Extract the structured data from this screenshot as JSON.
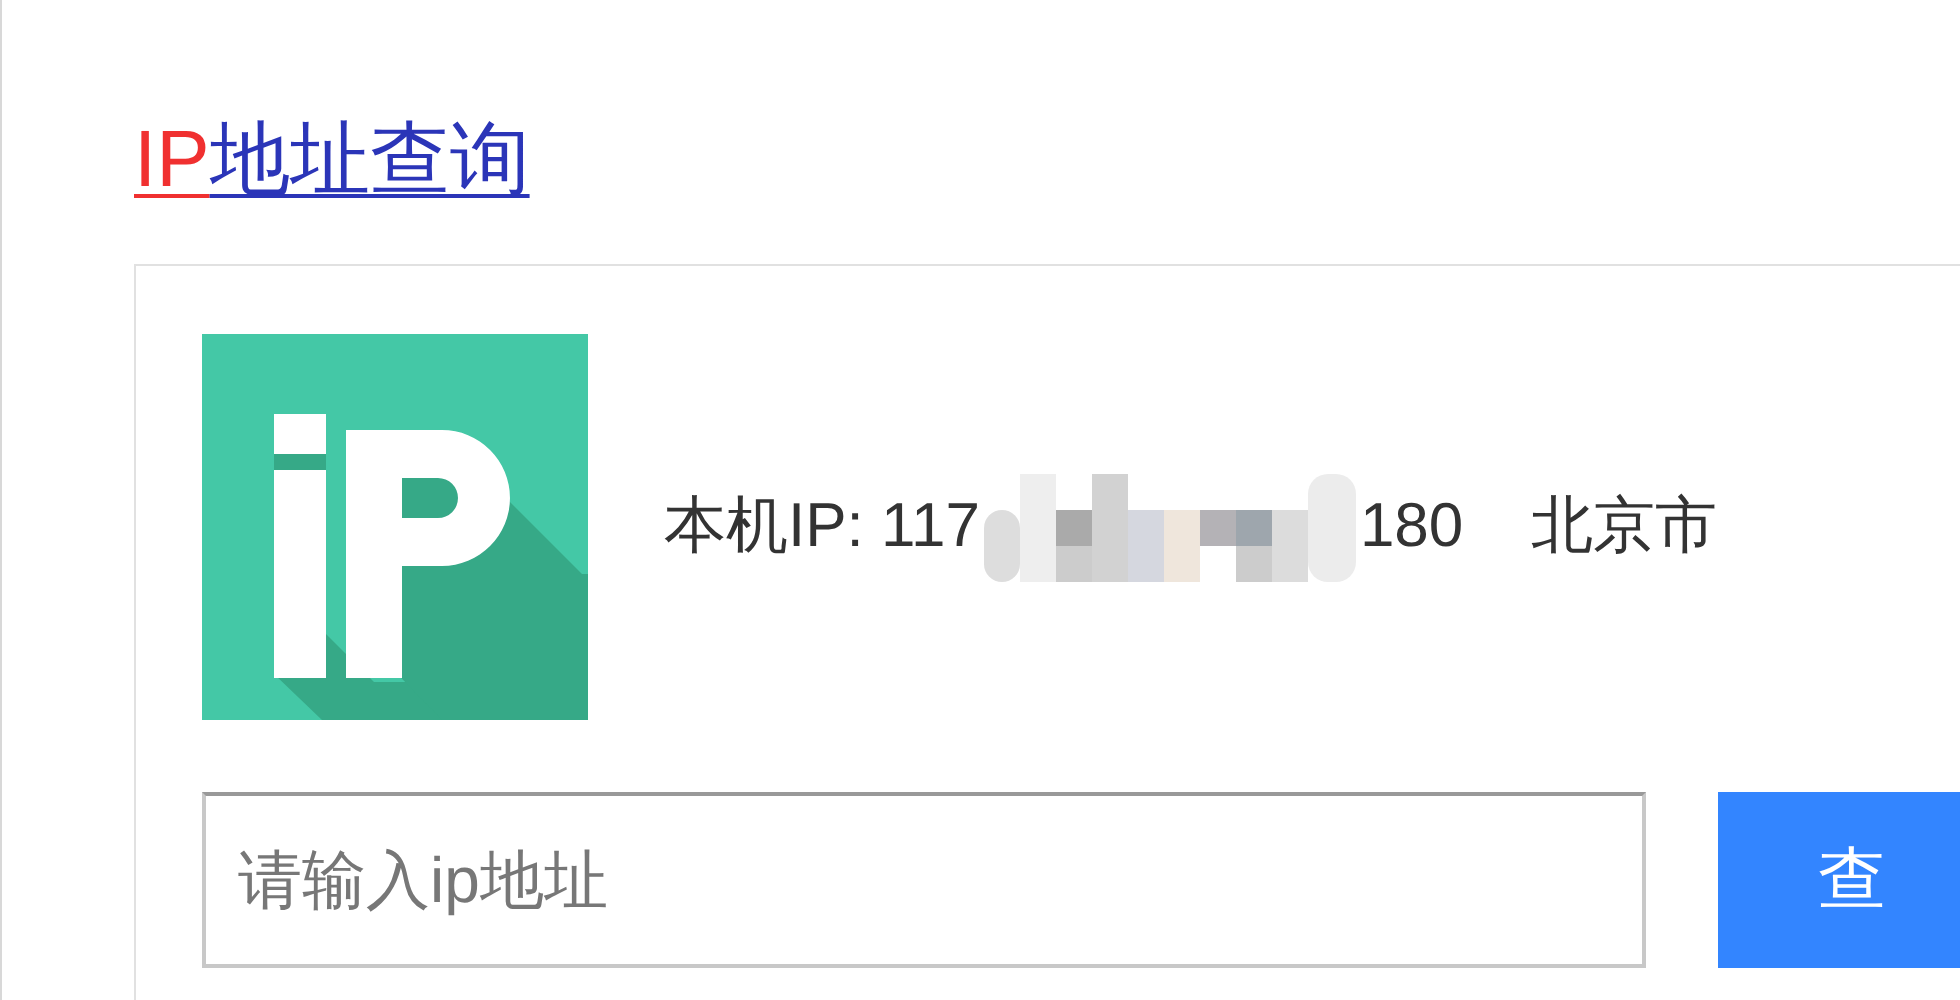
{
  "title": {
    "parts": [
      {
        "text": "IP",
        "highlighted": true
      },
      {
        "text": "地址查询",
        "highlighted": false
      }
    ]
  },
  "local_ip": {
    "label": "本机IP: 117",
    "suffix": "180",
    "location": "北京市"
  },
  "search": {
    "placeholder": "请输入ip地址"
  },
  "button": "查"
}
